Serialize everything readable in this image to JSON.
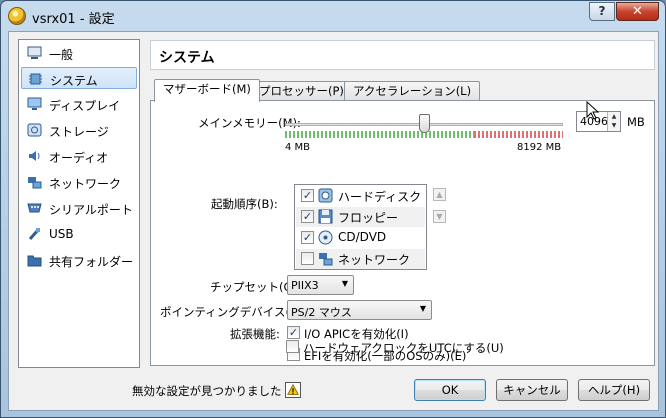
{
  "window": {
    "title": "vsrx01 - 設定",
    "help_glyph": "?",
    "close_glyph": "✕"
  },
  "sidebar": {
    "items": [
      {
        "label": "一般",
        "icon": "general-icon"
      },
      {
        "label": "システム",
        "icon": "system-chip-icon",
        "selected": true
      },
      {
        "label": "ディスプレイ",
        "icon": "display-monitor-icon"
      },
      {
        "label": "ストレージ",
        "icon": "storage-disk-icon"
      },
      {
        "label": "オーディオ",
        "icon": "audio-speaker-icon"
      },
      {
        "label": "ネットワーク",
        "icon": "network-icon"
      },
      {
        "label": "シリアルポート",
        "icon": "serial-port-icon"
      },
      {
        "label": "USB",
        "icon": "usb-icon"
      },
      {
        "label": "共有フォルダー",
        "icon": "shared-folder-icon"
      }
    ]
  },
  "section_title": "システム",
  "tabs": [
    {
      "label": "マザーボード(M)",
      "active": true
    },
    {
      "label": "プロセッサー(P)",
      "active": false
    },
    {
      "label": "アクセラレーション(L)",
      "active": false
    }
  ],
  "motherboard": {
    "memory": {
      "label": "メインメモリー(M):",
      "value": "4096",
      "unit": "MB",
      "min_label": "4 MB",
      "max_label": "8192 MB",
      "min_mb": 4,
      "max_mb": 8192,
      "current_mb": 4096
    },
    "boot_order": {
      "label": "起動順序(B):",
      "items": [
        {
          "label": "ハードディスク",
          "checked": true,
          "icon": "hard-disk-icon"
        },
        {
          "label": "フロッピー",
          "checked": true,
          "icon": "floppy-icon"
        },
        {
          "label": "CD/DVD",
          "checked": true,
          "icon": "cd-dvd-icon"
        },
        {
          "label": "ネットワーク",
          "checked": false,
          "icon": "network-boot-icon"
        }
      ],
      "move_up_glyph": "▲",
      "move_down_glyph": "▼"
    },
    "chipset": {
      "label": "チップセット(C):",
      "value": "PIIX3"
    },
    "pointing": {
      "label": "ポインティングデバイス(P):",
      "value": "PS/2 マウス"
    },
    "features": {
      "label": "拡張機能:",
      "options": [
        {
          "label": "I/O APICを有効化(I)",
          "checked": true
        },
        {
          "label": "EFIを有効化(一部のOSのみ)(E)",
          "checked": false
        },
        {
          "label": "ハードウェアクロックをUTCにする(U)",
          "checked": false
        }
      ]
    }
  },
  "footer": {
    "status_text": "無効な設定が見つかりました",
    "ok_label": "OK",
    "cancel_label": "キャンセル",
    "help_label": "ヘルプ(H)"
  },
  "colors": {
    "accent": "#84acdd",
    "slider_ok": "#6cc26c",
    "slider_warn": "#e07070"
  }
}
